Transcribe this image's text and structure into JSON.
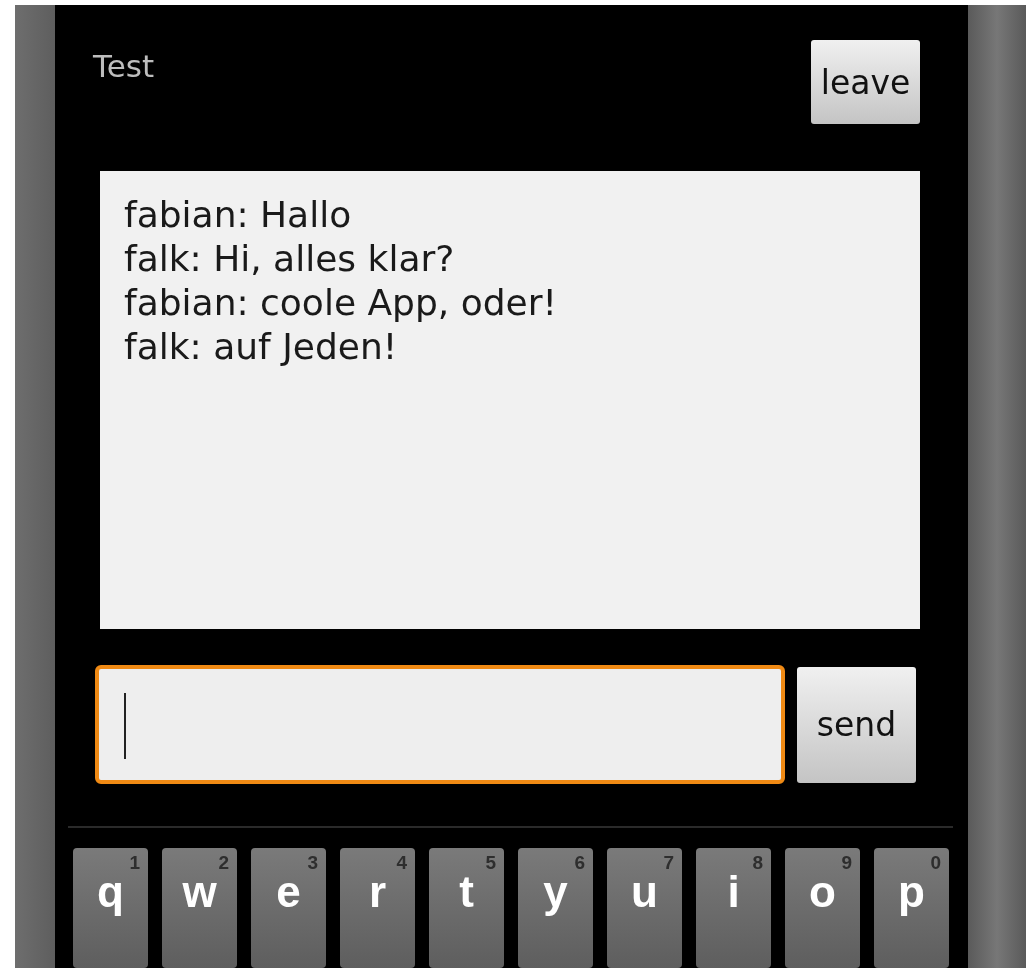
{
  "title": "Test",
  "leave_button": "leave",
  "messages": [
    "fabian: Hallo",
    "falk: Hi, alles klar?",
    "fabian: coole App, oder!",
    "falk: auf Jeden!"
  ],
  "input": {
    "focused": true
  },
  "send_button": "send",
  "keys": [
    {
      "letter": "q",
      "digit": "1"
    },
    {
      "letter": "w",
      "digit": "2"
    },
    {
      "letter": "e",
      "digit": "3"
    },
    {
      "letter": "r",
      "digit": "4"
    },
    {
      "letter": "t",
      "digit": "5"
    },
    {
      "letter": "y",
      "digit": "6"
    },
    {
      "letter": "u",
      "digit": "7"
    },
    {
      "letter": "i",
      "digit": "8"
    },
    {
      "letter": "o",
      "digit": "9"
    },
    {
      "letter": "p",
      "digit": "0"
    }
  ]
}
